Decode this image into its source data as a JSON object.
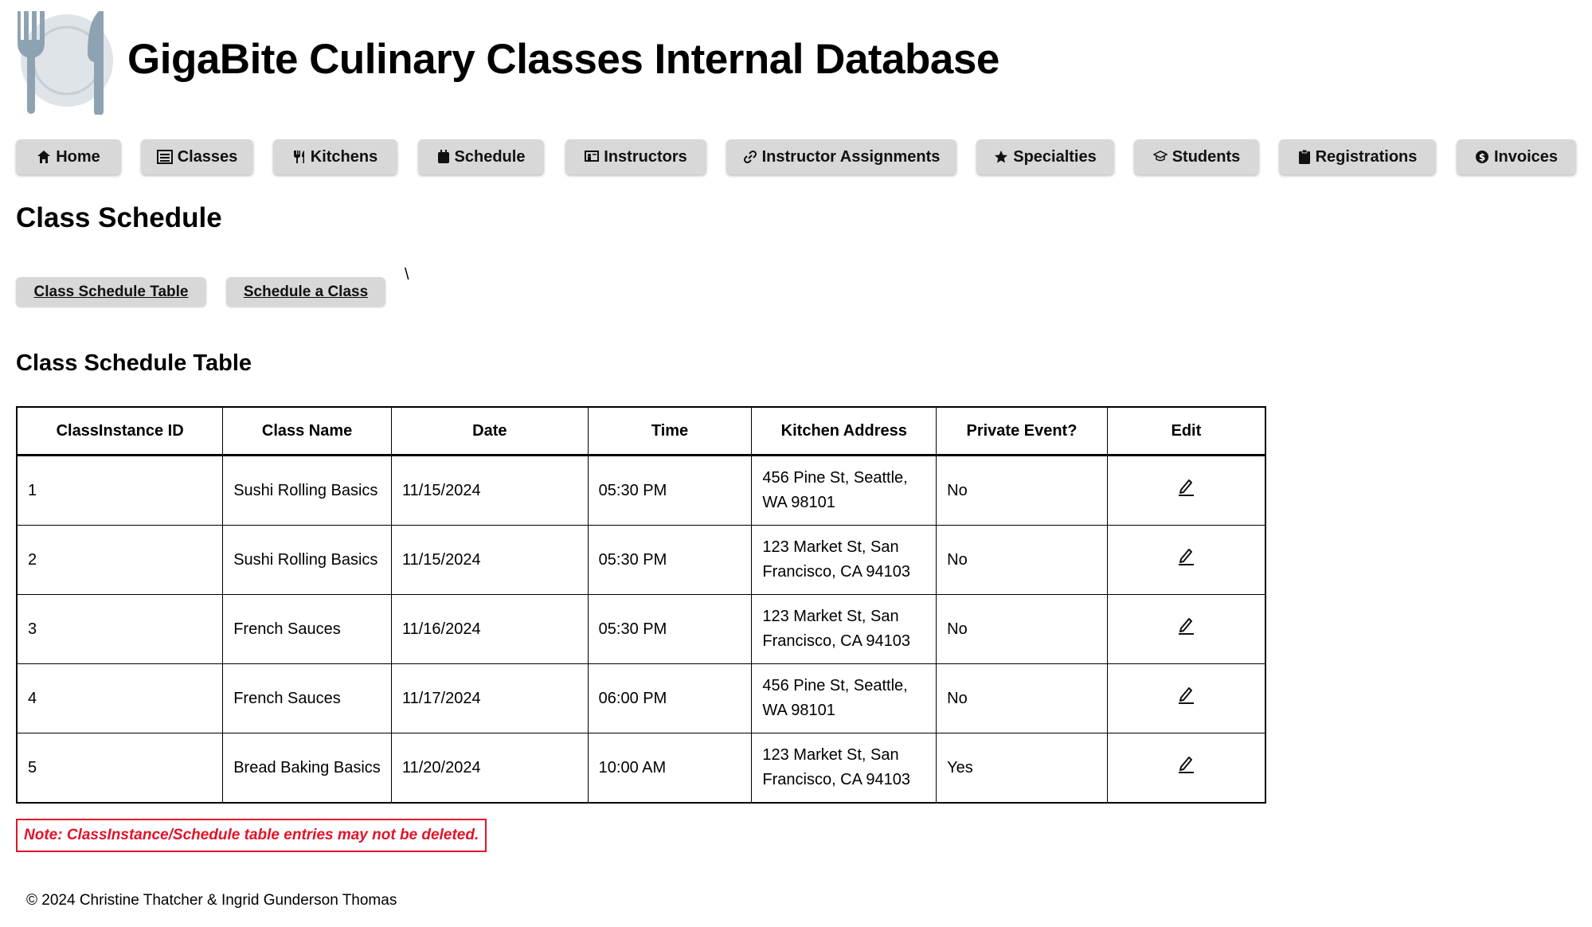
{
  "header": {
    "title": "GigaBite Culinary Classes Internal Database",
    "logo_icon": "plate-fork-knife-icon"
  },
  "nav": [
    {
      "label": "Home",
      "icon": "home-icon"
    },
    {
      "label": "Classes",
      "icon": "list-icon"
    },
    {
      "label": "Kitchens",
      "icon": "utensils-icon"
    },
    {
      "label": "Schedule",
      "icon": "calendar-icon"
    },
    {
      "label": "Instructors",
      "icon": "chalkboard-icon"
    },
    {
      "label": "Instructor Assignments",
      "icon": "link-icon"
    },
    {
      "label": "Specialties",
      "icon": "star-icon"
    },
    {
      "label": "Students",
      "icon": "graduation-cap-icon"
    },
    {
      "label": "Registrations",
      "icon": "clipboard-icon"
    },
    {
      "label": "Invoices",
      "icon": "dollar-circle-icon"
    }
  ],
  "page": {
    "title": "Class Schedule",
    "tabs": [
      "Class Schedule Table",
      "Schedule a Class"
    ],
    "stray_text": "\\",
    "section_title": "Class Schedule Table"
  },
  "table": {
    "headers": [
      "ClassInstance ID",
      "Class Name",
      "Date",
      "Time",
      "Kitchen Address",
      "Private Event?",
      "Edit"
    ],
    "rows": [
      {
        "id": "1",
        "name": "Sushi Rolling Basics",
        "date": "11/15/2024",
        "time": "05:30 PM",
        "addr1": "456 Pine St, Seattle,",
        "addr2": "WA 98101",
        "private": "No"
      },
      {
        "id": "2",
        "name": "Sushi Rolling Basics",
        "date": "11/15/2024",
        "time": "05:30 PM",
        "addr1": "123 Market St, San",
        "addr2": "Francisco, CA 94103",
        "private": "No"
      },
      {
        "id": "3",
        "name": "French Sauces",
        "date": "11/16/2024",
        "time": "05:30 PM",
        "addr1": "123 Market St, San",
        "addr2": "Francisco, CA 94103",
        "private": "No"
      },
      {
        "id": "4",
        "name": "French Sauces",
        "date": "11/17/2024",
        "time": "06:00 PM",
        "addr1": "456 Pine St, Seattle,",
        "addr2": "WA 98101",
        "private": "No"
      },
      {
        "id": "5",
        "name": "Bread Baking Basics",
        "date": "11/20/2024",
        "time": "10:00 AM",
        "addr1": "123 Market St, San",
        "addr2": "Francisco, CA 94103",
        "private": "Yes"
      }
    ]
  },
  "note": "Note: ClassInstance/Schedule table entries may not be deleted.",
  "footer": "© 2024 Christine Thatcher & Ingrid Gunderson Thomas",
  "colors": {
    "nav_bg": "#d8d8d8",
    "note_red": "#e0142a"
  }
}
